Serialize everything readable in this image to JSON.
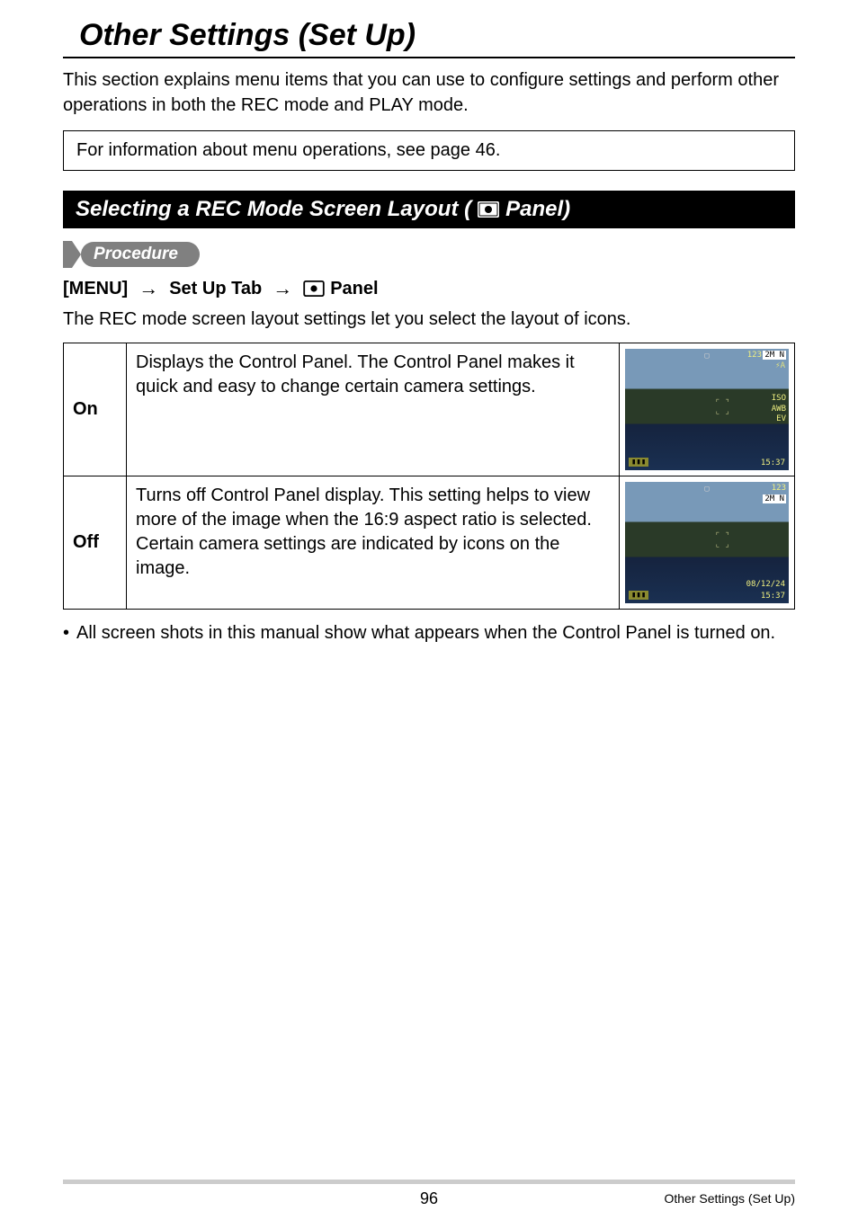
{
  "page_title": "Other Settings (Set Up)",
  "intro": "This section explains menu items that you can use to configure settings and perform other operations in both the REC mode and PLAY mode.",
  "info_box": "For information about menu operations, see page 46.",
  "section_header_pre": "Selecting a REC Mode Screen Layout (",
  "section_header_post": " Panel)",
  "procedure_label": "Procedure",
  "procedure": {
    "menu": "[MENU]",
    "setup": "Set Up Tab",
    "panel": " Panel"
  },
  "layout_intro": "The REC mode screen layout settings let you select the layout of icons.",
  "options": {
    "on": {
      "label": "On",
      "desc": "Displays the Control Panel. The Control Panel makes it quick and easy to change certain camera settings.",
      "osd": {
        "count": "123",
        "badge": "2M N",
        "flash": "⚡A",
        "iso": "ISO",
        "awb": "AWB",
        "ev": "EV",
        "time": "15:37",
        "battery": "▮▮▮"
      }
    },
    "off": {
      "label": "Off",
      "desc": "Turns off Control Panel display. This setting helps to view more of the image when the 16:9 aspect ratio is selected. Certain camera settings are indicated by icons on the image.",
      "osd": {
        "count": "123",
        "badge": "2M N",
        "date": "08/12/24",
        "time": "15:37",
        "battery": "▮▮▮"
      }
    }
  },
  "note": "All screen shots in this manual show what appears when the Control Panel is turned on.",
  "footer": {
    "page": "96",
    "chapter": "Other Settings (Set Up)"
  }
}
